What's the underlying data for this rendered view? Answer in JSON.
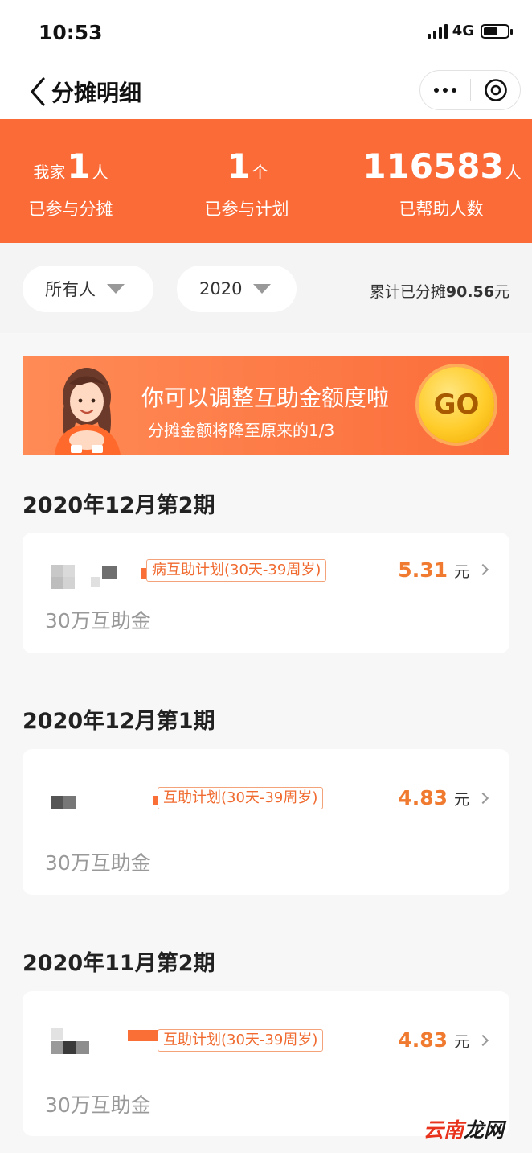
{
  "status_bar": {
    "time": "10:53",
    "network": "4G"
  },
  "nav": {
    "title": "分摊明细"
  },
  "stats": [
    {
      "prefix": "我家",
      "value": "1",
      "suffix": "人",
      "label": "已参与分摊"
    },
    {
      "prefix": "",
      "value": "1",
      "suffix": "个",
      "label": "已参与计划"
    },
    {
      "prefix": "",
      "value": "116583",
      "suffix": "人",
      "label": "已帮助人数"
    }
  ],
  "filters": {
    "member": "所有人",
    "year": "2020",
    "total_prefix": "累计已分摊",
    "total_amount": "90.56",
    "total_unit": "元"
  },
  "banner": {
    "title": "你可以调整互助金额度啦",
    "subtitle": "分摊金额将降至原来的1/3",
    "button": "GO"
  },
  "records": [
    {
      "period": "2020年12月第2期",
      "plan": "病互助计划(30天-39周岁)",
      "amount": "5.31",
      "unit": "元",
      "fund": "30万互助金"
    },
    {
      "period": "2020年12月第1期",
      "plan": "互助计划(30天-39周岁)",
      "amount": "4.83",
      "unit": "元",
      "fund": "30万互助金"
    },
    {
      "period": "2020年11月第2期",
      "plan": "互助计划(30天-39周岁)",
      "amount": "4.83",
      "unit": "元",
      "fund": "30万互助金"
    }
  ],
  "watermark": {
    "part1": "云南",
    "part2": "龙网"
  },
  "colors": {
    "brand_orange": "#fa6b37",
    "amount_orange": "#f07a2f",
    "page_bg": "#f5f5f5"
  }
}
